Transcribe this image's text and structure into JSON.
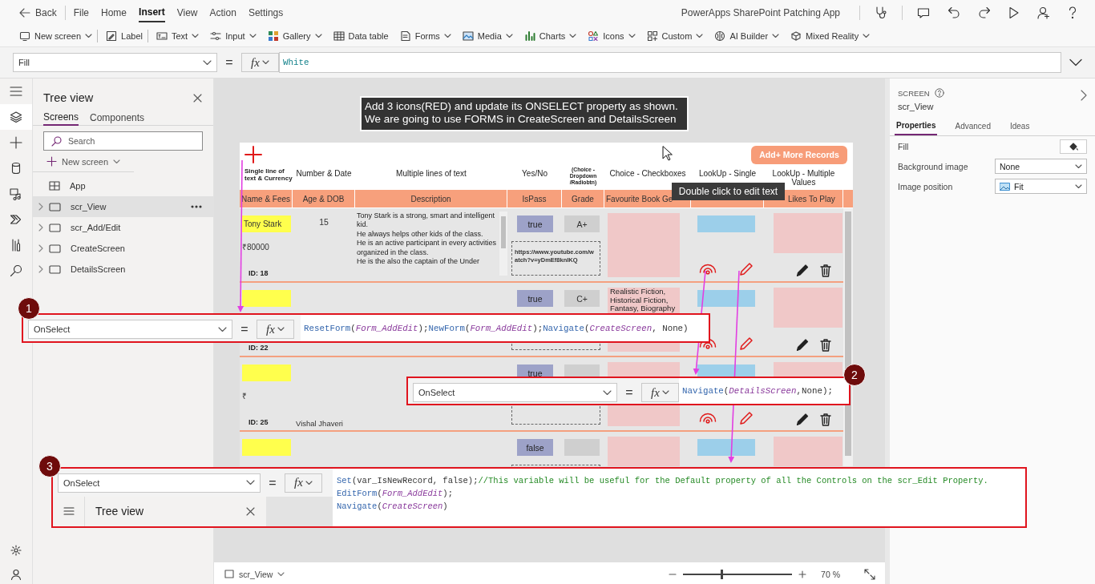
{
  "menu": {
    "back": "Back",
    "items": [
      {
        "label": "File",
        "selected": false
      },
      {
        "label": "Home",
        "selected": false
      },
      {
        "label": "Insert",
        "selected": true
      },
      {
        "label": "View",
        "selected": false
      },
      {
        "label": "Action",
        "selected": false
      },
      {
        "label": "Settings",
        "selected": false
      }
    ]
  },
  "app_title": "PowerApps SharePoint Patching App",
  "ribbon": [
    {
      "label": "New screen",
      "dropdown": true
    },
    {
      "label": "Label",
      "dropdown": false
    },
    {
      "label": "Text",
      "dropdown": true
    },
    {
      "label": "Input",
      "dropdown": true
    },
    {
      "label": "Gallery",
      "dropdown": true
    },
    {
      "label": "Data table",
      "dropdown": false
    },
    {
      "label": "Forms",
      "dropdown": true
    },
    {
      "label": "Media",
      "dropdown": true
    },
    {
      "label": "Charts",
      "dropdown": true
    },
    {
      "label": "Icons",
      "dropdown": true
    },
    {
      "label": "Custom",
      "dropdown": true
    },
    {
      "label": "AI Builder",
      "dropdown": true
    },
    {
      "label": "Mixed Reality",
      "dropdown": true
    }
  ],
  "formula_bar": {
    "property": "Fill",
    "equals": "=",
    "fx": "fx",
    "code": [
      [
        {
          "text": "White",
          "kind": "value"
        }
      ]
    ]
  },
  "tree_view": {
    "title": "Tree view",
    "tabs": [
      {
        "label": "Screens",
        "selected": true
      },
      {
        "label": "Components",
        "selected": false
      }
    ],
    "search_placeholder": "Search",
    "new_screen": "New screen",
    "items": [
      {
        "label": "App",
        "kind": "app",
        "selected": false
      },
      {
        "label": "scr_View",
        "kind": "screen",
        "selected": true
      },
      {
        "label": "scr_Add/Edit",
        "kind": "screen",
        "selected": false
      },
      {
        "label": "CreateScreen",
        "kind": "screen",
        "selected": false
      },
      {
        "label": "DetailsScreen",
        "kind": "screen",
        "selected": false
      }
    ]
  },
  "note": [
    "Add 3 icons(RED) and update its ONSELECT property as shown.",
    "We are going to use FORMS in CreateScreen and DetailsScreen"
  ],
  "app_screen": {
    "add_button": "Add+ More Records",
    "columns": [
      {
        "type": "Single line of text & Currency",
        "label": "Name & Fees"
      },
      {
        "type": "Number & Date",
        "label": "Age & DOB"
      },
      {
        "type": "Multiple lines of text",
        "label": "Description"
      },
      {
        "type": "Yes/No",
        "label": "IsPass"
      },
      {
        "type": "(Choice - Dropdown /Radiobtn)",
        "label": "Grade"
      },
      {
        "type": "Choice - Checkboxes",
        "label": "Favourite Book Ge"
      },
      {
        "type": "LookUp - Single"
      },
      {
        "type": "LookUp - Multiple Values",
        "label": "Likes To Play"
      }
    ],
    "rows": [
      {
        "name": "Tony Stark",
        "fees": "₹80000",
        "id": "ID: 18",
        "age": "15",
        "description": [
          "Tony Stark is a strong, smart and intelligent kid.",
          "He always helps other kids of the class.",
          "He is an active participant in every activities organized in the class.",
          "He is the also the captain of the Under"
        ],
        "is_pass": "true",
        "grade": "A+",
        "link_box": true,
        "link": "https://www.youtube.com/watch?v=yDmEf8knlKQ",
        "actions": true
      },
      {
        "id": "ID: 22",
        "is_pass": "true",
        "grade": "C+",
        "link_box": true,
        "books": [
          "Realistic Fiction,",
          "Historical Fiction,",
          "Fantasy, Biography"
        ],
        "actions": true
      },
      {
        "fees": "₹",
        "id": "ID: 25",
        "dob": "Vishal Jhaveri",
        "is_pass": "true",
        "link_box": true,
        "actions": true
      },
      {
        "is_pass": "false",
        "link_box": true,
        "actions": false
      }
    ]
  },
  "tooltip": "Double click to edit text",
  "status_bar": {
    "screen": "scr_View",
    "zoom": {
      "level": 0.35,
      "reading": "70 %"
    }
  },
  "properties_panel": {
    "type": "SCREEN",
    "name": "scr_View",
    "tabs": [
      {
        "label": "Properties",
        "selected": true
      },
      {
        "label": "Advanced",
        "selected": false
      },
      {
        "label": "Ideas",
        "selected": false
      }
    ],
    "rows": [
      {
        "label": "Fill",
        "kind": "color"
      },
      {
        "label": "Background image",
        "kind": "select",
        "value": "None"
      },
      {
        "label": "Image position",
        "kind": "image_select",
        "value": "Fit"
      }
    ]
  },
  "callouts": [
    {
      "number": "1",
      "property": "OnSelect",
      "equals": "=",
      "fx": "fx",
      "code": [
        [
          {
            "text": "ResetForm",
            "kind": "function"
          },
          {
            "text": "(",
            "kind": "plain"
          },
          {
            "text": "Form_AddEdit",
            "kind": "param"
          },
          {
            "text": ");",
            "kind": "plain"
          },
          {
            "text": "NewForm",
            "kind": "function"
          },
          {
            "text": "(",
            "kind": "plain"
          },
          {
            "text": "Form_AddEdit",
            "kind": "param"
          },
          {
            "text": ");",
            "kind": "plain"
          },
          {
            "text": "Navigate",
            "kind": "function"
          },
          {
            "text": "(",
            "kind": "plain"
          },
          {
            "text": "CreateScreen",
            "kind": "param"
          },
          {
            "text": ", None)",
            "kind": "plain"
          }
        ]
      ]
    },
    {
      "number": "2",
      "property": "OnSelect",
      "equals": "=",
      "fx": "fx",
      "code": [
        [
          {
            "text": "Navigate",
            "kind": "function"
          },
          {
            "text": "(",
            "kind": "plain"
          },
          {
            "text": "DetailsScreen",
            "kind": "param"
          },
          {
            "text": ",None);",
            "kind": "plain"
          }
        ]
      ]
    },
    {
      "number": "3",
      "property": "OnSelect",
      "equals": "=",
      "fx": "fx",
      "inset": {
        "title": "Tree view"
      },
      "code": [
        [
          {
            "text": "Set",
            "kind": "function"
          },
          {
            "text": "(var_IsNewRecord, false);",
            "kind": "plain"
          },
          {
            "text": "//This variable will be useful for the Default property of all the Controls on the scr_Edit Property.",
            "kind": "comment"
          }
        ],
        [
          {
            "text": "EditForm",
            "kind": "function"
          },
          {
            "text": "(",
            "kind": "plain"
          },
          {
            "text": "Form_AddEdit",
            "kind": "param"
          },
          {
            "text": ");",
            "kind": "plain"
          }
        ],
        [
          {
            "text": "Navigate",
            "kind": "function"
          },
          {
            "text": "(",
            "kind": "plain"
          },
          {
            "text": "CreateScreen",
            "kind": "param"
          },
          {
            "text": ")",
            "kind": "plain"
          }
        ]
      ]
    }
  ]
}
